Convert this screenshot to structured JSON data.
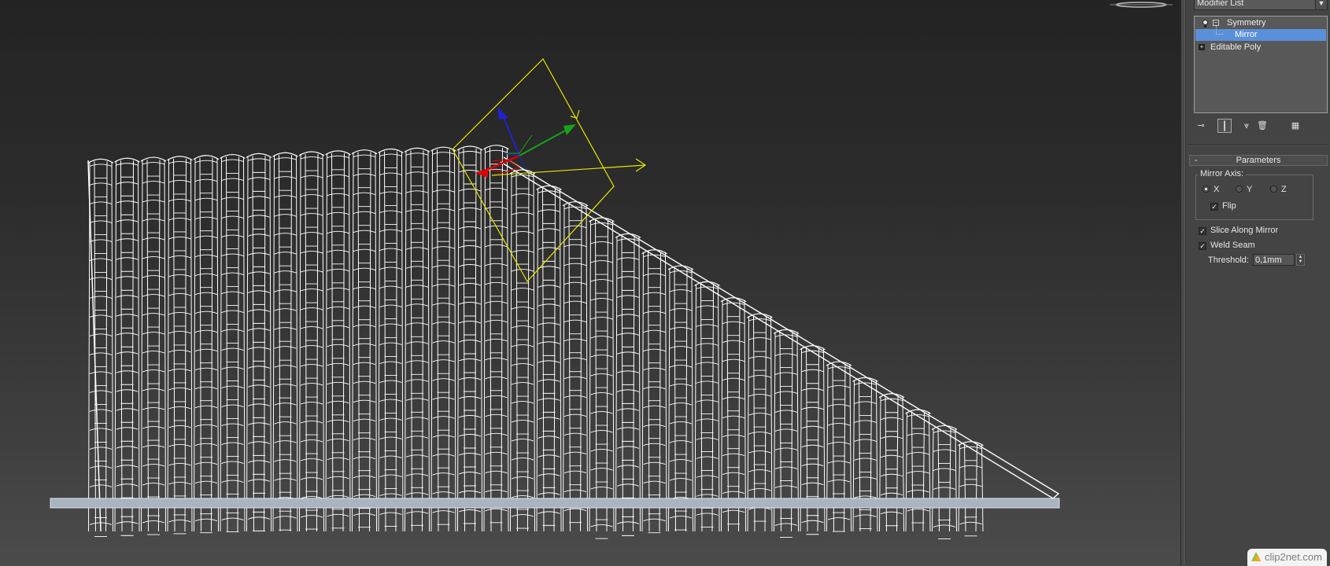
{
  "panel": {
    "modifier_list": "Modifier List",
    "stack": [
      {
        "label": "Symmetry",
        "state": "expanded"
      },
      {
        "label": "Mirror",
        "state": "selected"
      },
      {
        "label": "Editable Poly",
        "state": "collapsed"
      }
    ],
    "rollout_title": "Parameters",
    "mirror_axis_label": "Mirror Axis:",
    "axes": [
      "X",
      "Y",
      "Z"
    ],
    "selected_axis": "X",
    "flip_label": "Flip",
    "flip_checked": true,
    "slice_label": "Slice Along Mirror",
    "slice_checked": true,
    "weld_label": "Weld Seam",
    "weld_checked": true,
    "threshold_label": "Threshold:",
    "threshold_value": "0,1mm"
  },
  "icons": {
    "stack_toolbar": [
      "pin-stack-icon",
      "show-end-result-icon",
      "make-unique-icon",
      "remove-modifier-icon",
      "configure-modifier-sets-icon"
    ],
    "gizmo_axes": {
      "x": "#e00000",
      "y": "#17a317",
      "z": "#2222cc"
    },
    "gizmo_color": "#e6e600",
    "mesh_color": "#ffffff"
  },
  "watermark": {
    "text": "clip2net.com"
  }
}
